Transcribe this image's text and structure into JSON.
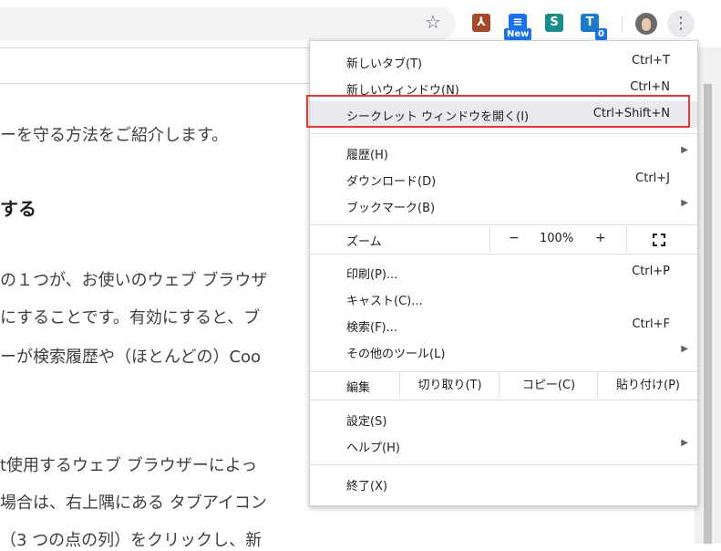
{
  "toolbar": {
    "icons": [
      "star-icon",
      "pdf-extension-icon",
      "news-extension-icon",
      "s-extension-icon",
      "tc-extension-icon",
      "profile-avatar",
      "more-menu-icon"
    ],
    "news_badge": "New",
    "tc_badge": "0",
    "s_letter": "S",
    "tc_letter": "T"
  },
  "article": {
    "line1": "ーを守る方法をご紹介します。",
    "heading": "する",
    "line2": "の１つが、お使いのウェブ ブラウザ",
    "line3": "にすることです。有効にすると、ブ",
    "line4": "ーが検索履歴や（ほとんどの）Coo",
    "line5": "t使用するウェブ ブラウザーによっ",
    "line6": "場合は、右上隅にある タブアイコン",
    "line7": "（3 つの点の列）をクリックし、新"
  },
  "menu": {
    "new_tab": {
      "label": "新しいタブ(T)",
      "shortcut": "Ctrl+T"
    },
    "new_window": {
      "label": "新しいウィンドウ(N)",
      "shortcut": "Ctrl+N"
    },
    "incognito": {
      "label": "シークレット ウィンドウを開く(I)",
      "shortcut": "Ctrl+Shift+N"
    },
    "history": {
      "label": "履歴(H)"
    },
    "downloads": {
      "label": "ダウンロード(D)",
      "shortcut": "Ctrl+J"
    },
    "bookmarks": {
      "label": "ブックマーク(B)"
    },
    "zoom": {
      "label": "ズーム",
      "minus": "−",
      "value": "100%",
      "plus": "+"
    },
    "print": {
      "label": "印刷(P)...",
      "shortcut": "Ctrl+P"
    },
    "cast": {
      "label": "キャスト(C)..."
    },
    "find": {
      "label": "検索(F)...",
      "shortcut": "Ctrl+F"
    },
    "more_tools": {
      "label": "その他のツール(L)"
    },
    "edit": {
      "label": "編集",
      "cut": "切り取り(T)",
      "copy": "コピー(C)",
      "paste": "貼り付け(P)"
    },
    "settings": {
      "label": "設定(S)"
    },
    "help": {
      "label": "ヘルプ(H)"
    },
    "exit": {
      "label": "終了(X)"
    }
  },
  "colors": {
    "highlight_border": "#e53935",
    "hover_bg": "#e8eaed"
  }
}
